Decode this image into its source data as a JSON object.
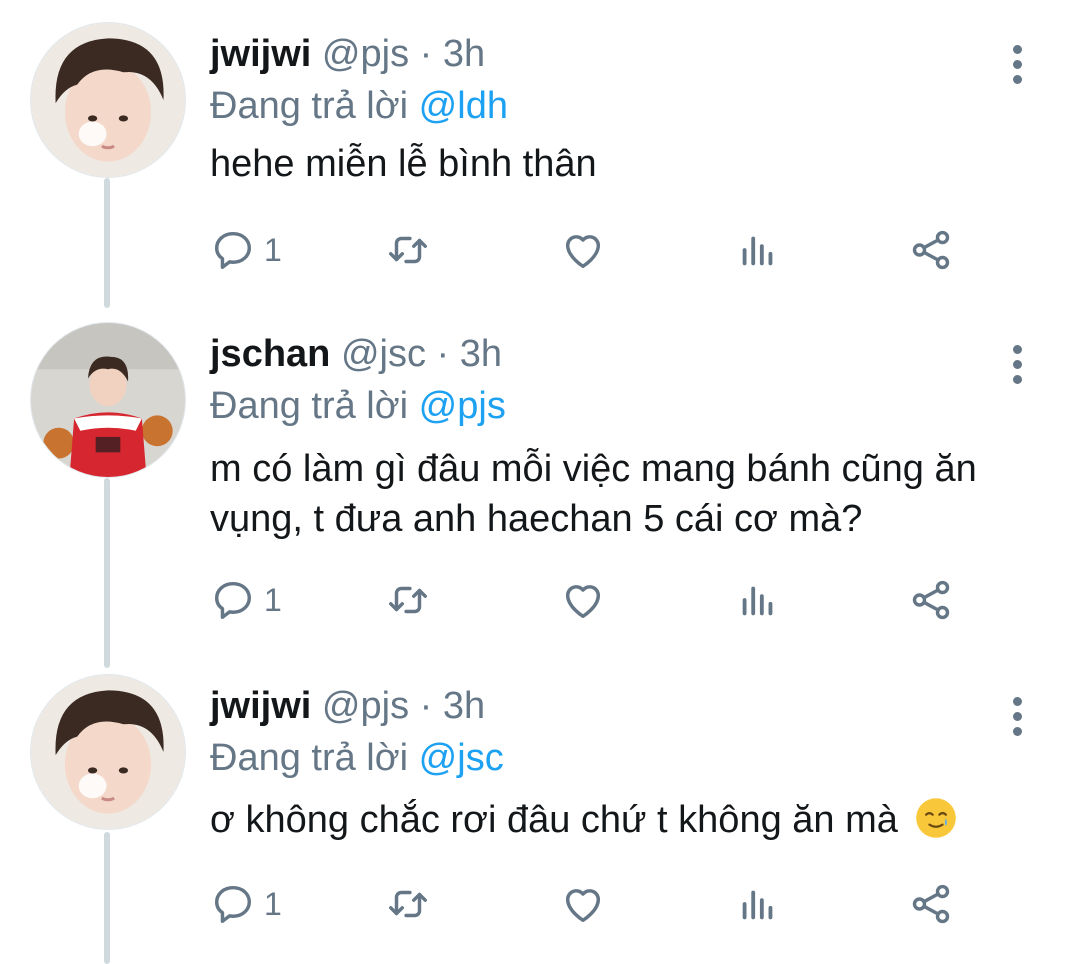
{
  "colors": {
    "text": "#14171a",
    "muted": "#657786",
    "mention": "#1da1f2",
    "thread_line": "#cfd9de"
  },
  "tweets": [
    {
      "name": "jwijwi",
      "handle": "@pjs",
      "separator": "·",
      "time": "3h",
      "reply_prefix": "Đang trả lời",
      "reply_to": "@ldh",
      "text": "hehe miễn lễ bình thân",
      "reply_count": "1",
      "avatar": "avatar-pjs"
    },
    {
      "name": "jschan",
      "handle": "@jsc",
      "separator": "·",
      "time": "3h",
      "reply_prefix": "Đang trả lời",
      "reply_to": "@pjs",
      "text": "m có làm gì đâu mỗi việc mang bánh cũng ăn vụng, t đưa anh haechan 5 cái cơ mà?",
      "reply_count": "1",
      "avatar": "avatar-jsc"
    },
    {
      "name": "jwijwi",
      "handle": "@pjs",
      "separator": "·",
      "time": "3h",
      "reply_prefix": "Đang trả lời",
      "reply_to": "@jsc",
      "text": "ơ không chắc rơi đâu chứ t không ăn mà",
      "reply_count": "1",
      "avatar": "avatar-pjs",
      "emoji": "smiling-face-with-tear"
    }
  ],
  "icons": {
    "reply": "reply-icon",
    "retweet": "retweet-icon",
    "like": "heart-icon",
    "stats": "stats-icon",
    "share": "share-icon",
    "more": "more-vertical-icon"
  }
}
